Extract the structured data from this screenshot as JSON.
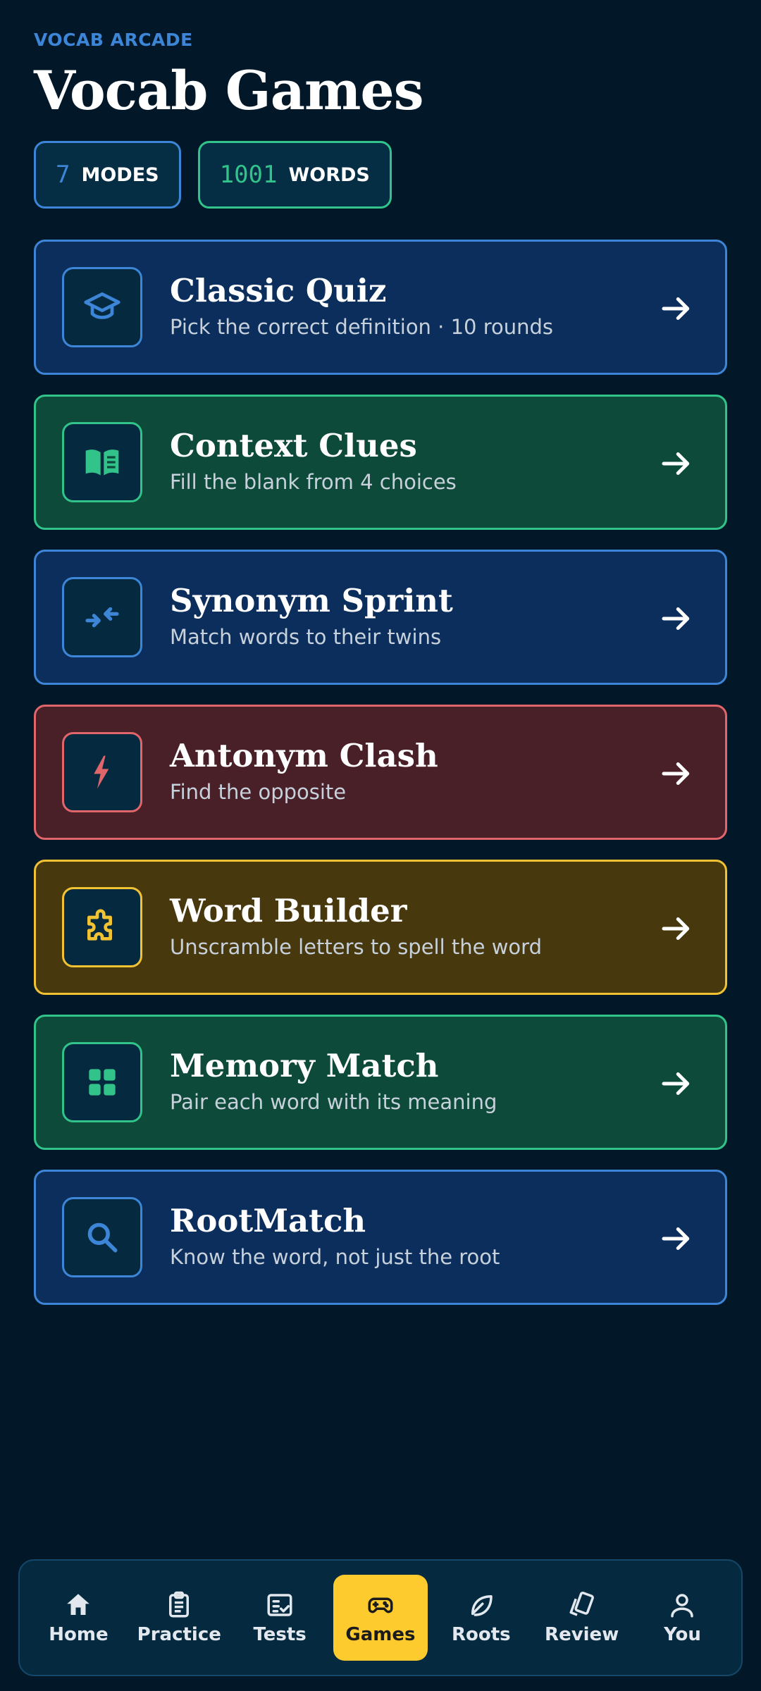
{
  "header": {
    "eyebrow": "VOCAB ARCADE",
    "title": "Vocab Games",
    "stats": [
      {
        "value": "7",
        "label": "MODES",
        "color": "#3d85d6"
      },
      {
        "value": "1001",
        "label": "WORDS",
        "color": "#32c38a"
      }
    ]
  },
  "games": [
    {
      "title": "Classic Quiz",
      "subtitle": "Pick the correct definition · 10 rounds",
      "icon": "graduation-cap-icon",
      "accent": "#3d85d6"
    },
    {
      "title": "Context Clues",
      "subtitle": "Fill the blank from 4 choices",
      "icon": "open-book-icon",
      "accent": "#32c38a"
    },
    {
      "title": "Synonym Sprint",
      "subtitle": "Match words to their twins",
      "icon": "arrows-converge-icon",
      "accent": "#3d85d6"
    },
    {
      "title": "Antonym Clash",
      "subtitle": "Find the opposite",
      "icon": "lightning-icon",
      "accent": "#e0666c"
    },
    {
      "title": "Word Builder",
      "subtitle": "Unscramble letters to spell the word",
      "icon": "puzzle-icon",
      "accent": "#f1c232"
    },
    {
      "title": "Memory Match",
      "subtitle": "Pair each word with its meaning",
      "icon": "grid-icon",
      "accent": "#32c38a"
    },
    {
      "title": "RootMatch",
      "subtitle": "Know the word, not just the root",
      "icon": "search-icon",
      "accent": "#3d85d6"
    }
  ],
  "nav": {
    "items": [
      {
        "label": "Home",
        "icon": "home-icon"
      },
      {
        "label": "Practice",
        "icon": "clipboard-icon"
      },
      {
        "label": "Tests",
        "icon": "checklist-icon"
      },
      {
        "label": "Games",
        "icon": "gamepad-icon",
        "active": true
      },
      {
        "label": "Roots",
        "icon": "leaf-icon"
      },
      {
        "label": "Review",
        "icon": "cards-icon"
      },
      {
        "label": "You",
        "icon": "user-icon"
      }
    ],
    "active_color": "#fecb2f"
  }
}
